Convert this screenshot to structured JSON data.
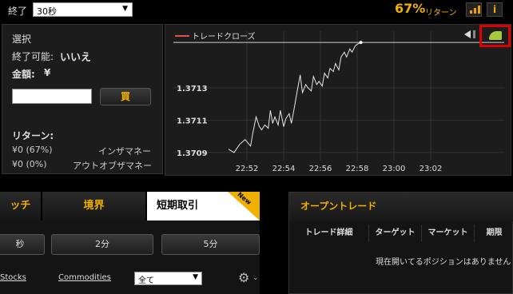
{
  "topbar": {
    "expiry_label": "終了",
    "expiry_value": "30秒",
    "payout_pct": "67%",
    "payout_label": "リターン",
    "info_label": "i"
  },
  "left_panel": {
    "select_label": "選択",
    "expiry_possible": "終了可能:",
    "expiry_possible_value": "いいえ",
    "amount_label": "金額:",
    "currency": "¥",
    "amount_value": "",
    "buy_label": "買",
    "return_label": "リターン:",
    "return_in": "¥0 (67%)",
    "return_in_label": "インザマネー",
    "return_out": "¥0 (0%)",
    "return_out_label": "アウトオブザマネー"
  },
  "chart_data": {
    "type": "line",
    "legend": "トレードクローズ",
    "x_ticks": [
      "22:52",
      "22:54",
      "22:56",
      "22:58",
      "23:00",
      "23:02"
    ],
    "y_ticks": [
      "1.3713",
      "1.3711",
      "1.3709"
    ],
    "y_tick_values": [
      1.3713,
      1.3711,
      1.3709
    ],
    "x_range": [
      22.8,
      23.1
    ],
    "ylim": [
      1.37085,
      1.37165
    ],
    "trade_close_level": 1.37158,
    "series": [
      {
        "x": [
          22.85,
          22.855,
          22.86,
          22.865,
          22.87,
          22.872,
          22.875,
          22.878,
          22.88,
          22.883,
          22.886,
          22.888,
          22.89,
          22.892,
          22.895,
          22.897,
          22.9,
          22.902,
          22.905,
          22.907,
          22.91,
          22.912,
          22.915,
          22.917,
          22.92,
          22.922,
          22.925,
          22.927,
          22.93,
          22.932,
          22.935,
          22.937,
          22.94,
          22.942,
          22.945,
          22.947,
          22.95,
          22.952,
          22.955,
          22.957,
          22.96,
          22.962,
          22.965,
          22.967,
          22.97
        ],
        "y": [
          1.37092,
          1.3709,
          1.37095,
          1.37098,
          1.37094,
          1.37102,
          1.37112,
          1.37106,
          1.37104,
          1.37107,
          1.37105,
          1.37116,
          1.37108,
          1.37112,
          1.37107,
          1.37116,
          1.37106,
          1.37111,
          1.37114,
          1.37108,
          1.37119,
          1.37127,
          1.37138,
          1.37127,
          1.37132,
          1.3713,
          1.37128,
          1.37137,
          1.37132,
          1.37134,
          1.37131,
          1.37139,
          1.37136,
          1.37142,
          1.3714,
          1.37145,
          1.37141,
          1.37149,
          1.37152,
          1.37149,
          1.37154,
          1.37152,
          1.37156,
          1.37157,
          1.37158
        ]
      }
    ]
  },
  "trade_tabs": [
    {
      "label": "ッチ"
    },
    {
      "label": "境界"
    },
    {
      "label": "短期取引"
    }
  ],
  "new_badge": "New",
  "durations": [
    "秒",
    "2分",
    "5分"
  ],
  "categories": {
    "stocks": "Stocks",
    "commodities": "Commodities",
    "filter_value": "全て"
  },
  "open_trades": {
    "title": "オープントレード",
    "columns": [
      "トレード詳細",
      "ターゲット",
      "マーケット",
      "期限"
    ],
    "empty_message": "現在開いてるポジションはありません"
  },
  "colors": {
    "accent": "#f0b000",
    "trade_close_line": "#e05050",
    "highlight": "#e00000"
  }
}
